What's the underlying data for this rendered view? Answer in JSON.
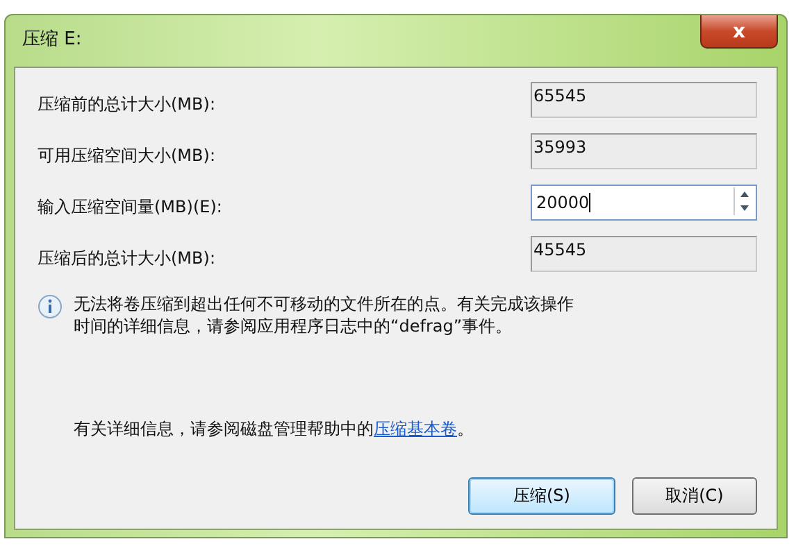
{
  "window": {
    "title": "压缩 E:",
    "close": "x"
  },
  "fields": [
    {
      "label": "压缩前的总计大小(MB):",
      "value": "65545",
      "kind": "readonly"
    },
    {
      "label": "可用压缩空间大小(MB):",
      "value": "35993",
      "kind": "readonly"
    },
    {
      "label": "输入压缩空间量(MB)(E):",
      "value": "20000",
      "kind": "spin"
    },
    {
      "label": "压缩后的总计大小(MB):",
      "value": "45545",
      "kind": "readonly"
    }
  ],
  "info": "无法将卷压缩到超出任何不可移动的文件所在的点。有关完成该操作时间的详细信息，请参阅应用程序日志中的“defrag”事件。",
  "help": {
    "text": "有关详细信息，请参阅磁盘管理帮助中的",
    "link": "压缩基本卷",
    "end": "。"
  },
  "buttons": [
    {
      "label": "压缩(S)",
      "default": true
    },
    {
      "label": "取消(C)",
      "default": false
    }
  ]
}
